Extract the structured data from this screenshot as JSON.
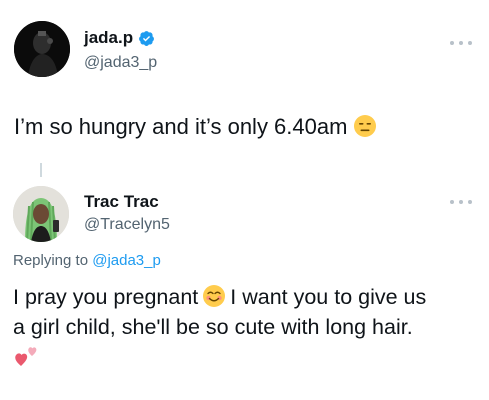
{
  "tweet": {
    "author": {
      "display_name": "jada.p",
      "handle": "@jada3_p",
      "verified": true,
      "avatar_icon": "dark-portrait-avatar"
    },
    "text": "I’m so hungry and it’s only 6.40am",
    "emoji": "expressionless-face-emoji",
    "more_icon": "ellipsis-icon"
  },
  "reply": {
    "author": {
      "display_name": "Trac Trac",
      "handle": "@Tracelyn5",
      "avatar_icon": "green-braids-avatar"
    },
    "replying_prefix": "Replying to",
    "replying_mention": "@jada3_p",
    "text_part1": "I pray you pregnant",
    "text_part2": "I want you to give us",
    "text_line2": "a girl child, she'll be so cute with long hair.",
    "emojis": [
      "smiling-face-emoji",
      "two-hearts-emoji"
    ],
    "more_icon": "ellipsis-icon"
  },
  "colors": {
    "text_primary": "#0f1419",
    "text_secondary": "#536471",
    "link": "#1d9bf0",
    "verified": "#1d9bf0"
  }
}
